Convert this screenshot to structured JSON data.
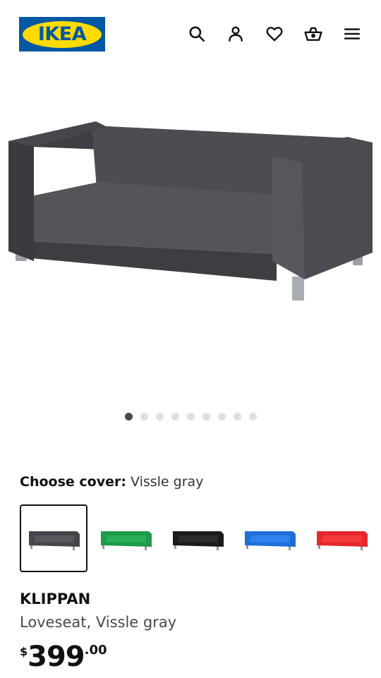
{
  "header": {
    "logo_text": "IKEA",
    "icons": [
      "search-icon",
      "user-icon",
      "heart-icon",
      "basket-icon",
      "menu-icon"
    ],
    "brand_blue": "#0058a3",
    "brand_yellow": "#ffdb00"
  },
  "gallery": {
    "image_count": 9,
    "active_index": 0
  },
  "cover": {
    "label": "Choose cover:",
    "value": "Vissle gray",
    "options": [
      {
        "name": "Vissle gray",
        "color": "#45464b",
        "selected": true
      },
      {
        "name": "green",
        "color": "#1e9a48",
        "selected": false
      },
      {
        "name": "black",
        "color": "#1b1b1d",
        "selected": false
      },
      {
        "name": "blue",
        "color": "#1f6fd8",
        "selected": false
      },
      {
        "name": "red",
        "color": "#e6262a",
        "selected": false
      }
    ]
  },
  "product": {
    "name": "KLIPPAN",
    "description": "Loveseat, Vissle gray",
    "price_currency": "$",
    "price_integer": "399",
    "price_decimal": ".00"
  }
}
